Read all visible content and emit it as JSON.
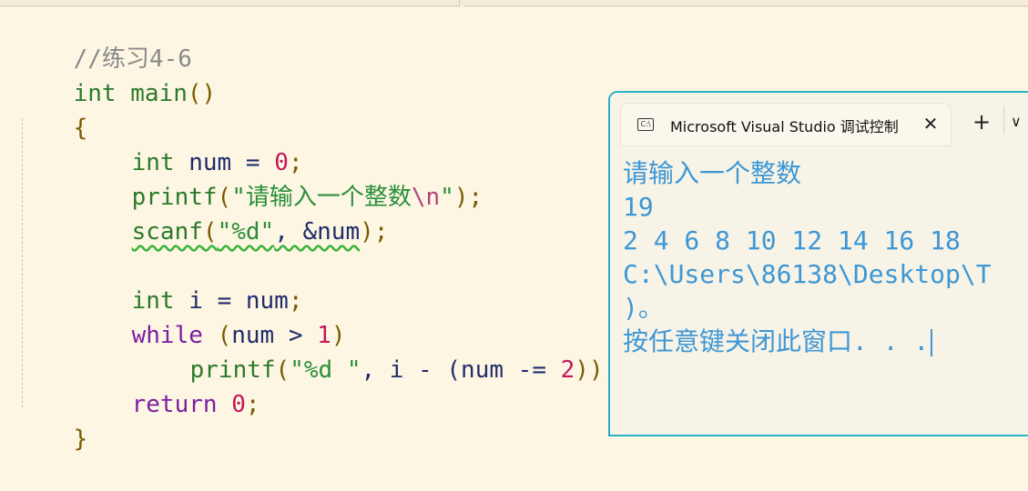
{
  "editor": {
    "comment": "//练习4-6",
    "line_main": {
      "type": "int",
      "name": "main",
      "parens": "()"
    },
    "brace_open": "{",
    "line_decl": {
      "type": "int",
      "var": "num",
      "op": "=",
      "value": "0",
      "end": ";"
    },
    "line_printf1": {
      "fn": "printf",
      "open": "(",
      "str_start": "\"请输入一个整数",
      "escape": "\\n",
      "str_end": "\"",
      "close": ");"
    },
    "line_scanf": {
      "fn": "scanf",
      "open": "(",
      "str": "\"%d\"",
      "rest": ", &num",
      "close": ");"
    },
    "line_int_i": {
      "type": "int",
      "var": "i",
      "op": "=",
      "value": "num",
      "end": ";"
    },
    "line_while": {
      "kw": "while",
      "open": "(",
      "cond_var": "num",
      "op": ">",
      "num": "1",
      "close": ")"
    },
    "line_printf2": {
      "fn": "printf",
      "open": "(",
      "str": "\"%d \"",
      "sep": ", i - (num -= ",
      "num": "2",
      "close": "));"
    },
    "line_return": {
      "kw": "return",
      "value": "0",
      "end": ";"
    },
    "brace_close": "}"
  },
  "console": {
    "tab_icon_text": "C:\\",
    "tab_title": "Microsoft Visual Studio 调试控制台",
    "close_glyph": "✕",
    "new_tab_glyph": "+",
    "dropdown_glyph": "∨",
    "lines": [
      "请输入一个整数",
      "19",
      "2 4 6 8 10 12 14 16 18",
      "C:\\Users\\86138\\Desktop\\T",
      ")。",
      "按任意键关闭此窗口. . ."
    ]
  }
}
